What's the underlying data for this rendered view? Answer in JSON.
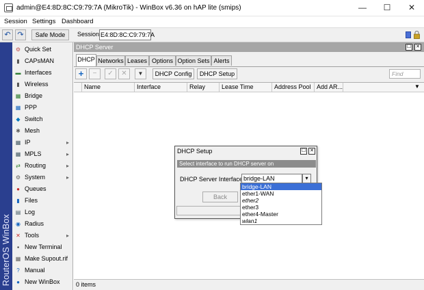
{
  "window": {
    "title": "admin@E4:8D:8C:C9:79:7A (MikroTik) - WinBox v6.36 on hAP lite (smips)",
    "minimize": "—",
    "maximize": "☐",
    "close": "✕"
  },
  "menubar": [
    "Session",
    "Settings",
    "Dashboard"
  ],
  "toolbar": {
    "undo_icon": "↶",
    "redo_icon": "↷",
    "safe_mode": "Safe Mode",
    "session_label": "Session:",
    "session_value": "E4:8D:8C:C9:79:7A"
  },
  "sidebar": {
    "brand": "RouterOS WinBox",
    "items": [
      {
        "label": "Quick Set",
        "icon": "⚙",
        "color": "#c0504d",
        "sub": false
      },
      {
        "label": "CAPsMAN",
        "icon": "▮",
        "color": "#555555",
        "sub": false
      },
      {
        "label": "Interfaces",
        "icon": "▬",
        "color": "#2e7d32",
        "sub": false
      },
      {
        "label": "Wireless",
        "icon": "▮",
        "color": "#555555",
        "sub": false
      },
      {
        "label": "Bridge",
        "icon": "▦",
        "color": "#2e7d32",
        "sub": false
      },
      {
        "label": "PPP",
        "icon": "▦",
        "color": "#1565c0",
        "sub": false
      },
      {
        "label": "Switch",
        "icon": "◆",
        "color": "#0277bd",
        "sub": false
      },
      {
        "label": "Mesh",
        "icon": "✱",
        "color": "#616161",
        "sub": false
      },
      {
        "label": "IP",
        "icon": "▦",
        "color": "#455a64",
        "sub": true
      },
      {
        "label": "MPLS",
        "icon": "▦",
        "color": "#455a64",
        "sub": true
      },
      {
        "label": "Routing",
        "icon": "⇄",
        "color": "#2e7d32",
        "sub": true
      },
      {
        "label": "System",
        "icon": "⚙",
        "color": "#616161",
        "sub": true
      },
      {
        "label": "Queues",
        "icon": "●",
        "color": "#c62828",
        "sub": false
      },
      {
        "label": "Files",
        "icon": "▮",
        "color": "#1565c0",
        "sub": false
      },
      {
        "label": "Log",
        "icon": "▤",
        "color": "#455a64",
        "sub": false
      },
      {
        "label": "Radius",
        "icon": "◉",
        "color": "#1565c0",
        "sub": false
      },
      {
        "label": "Tools",
        "icon": "✕",
        "color": "#c62828",
        "sub": true
      },
      {
        "label": "New Terminal",
        "icon": "▪",
        "color": "#212121",
        "sub": false
      },
      {
        "label": "Make Supout.rif",
        "icon": "▦",
        "color": "#616161",
        "sub": false
      },
      {
        "label": "Manual",
        "icon": "?",
        "color": "#1565c0",
        "sub": false
      },
      {
        "label": "New WinBox",
        "icon": "●",
        "color": "#1565c0",
        "sub": false
      }
    ]
  },
  "dhcp_window": {
    "title": "DHCP Server",
    "tabs": [
      "DHCP",
      "Networks",
      "Leases",
      "Options",
      "Option Sets",
      "Alerts"
    ],
    "active_tab": "DHCP",
    "buttons": {
      "add": "+",
      "remove": "−",
      "enable": "✓",
      "disable": "✕",
      "filter": "▼",
      "dhcp_config": "DHCP Config",
      "dhcp_setup": "DHCP Setup"
    },
    "find_placeholder": "Find",
    "columns": [
      "Name",
      "Interface",
      "Relay",
      "Lease Time",
      "Address Pool",
      "Add AR..."
    ],
    "status": "0 items"
  },
  "dialog": {
    "title": "DHCP Setup",
    "banner": "Select interface to run DHCP server on",
    "field_label": "DHCP Server Interface:",
    "field_value": "bridge-LAN",
    "back": "Back",
    "options": [
      {
        "label": "bridge-LAN",
        "selected": true,
        "italic": false
      },
      {
        "label": "ether1-WAN",
        "selected": false,
        "italic": false
      },
      {
        "label": "ether2",
        "selected": false,
        "italic": true
      },
      {
        "label": "ether3",
        "selected": false,
        "italic": false
      },
      {
        "label": "ether4-Master",
        "selected": false,
        "italic": false
      },
      {
        "label": "wlan1",
        "selected": false,
        "italic": true
      }
    ]
  },
  "colors": {
    "sidebar_strip": "#2a3f8f",
    "header_grey": "#a6a6a6",
    "selection": "#3b6fd6"
  }
}
